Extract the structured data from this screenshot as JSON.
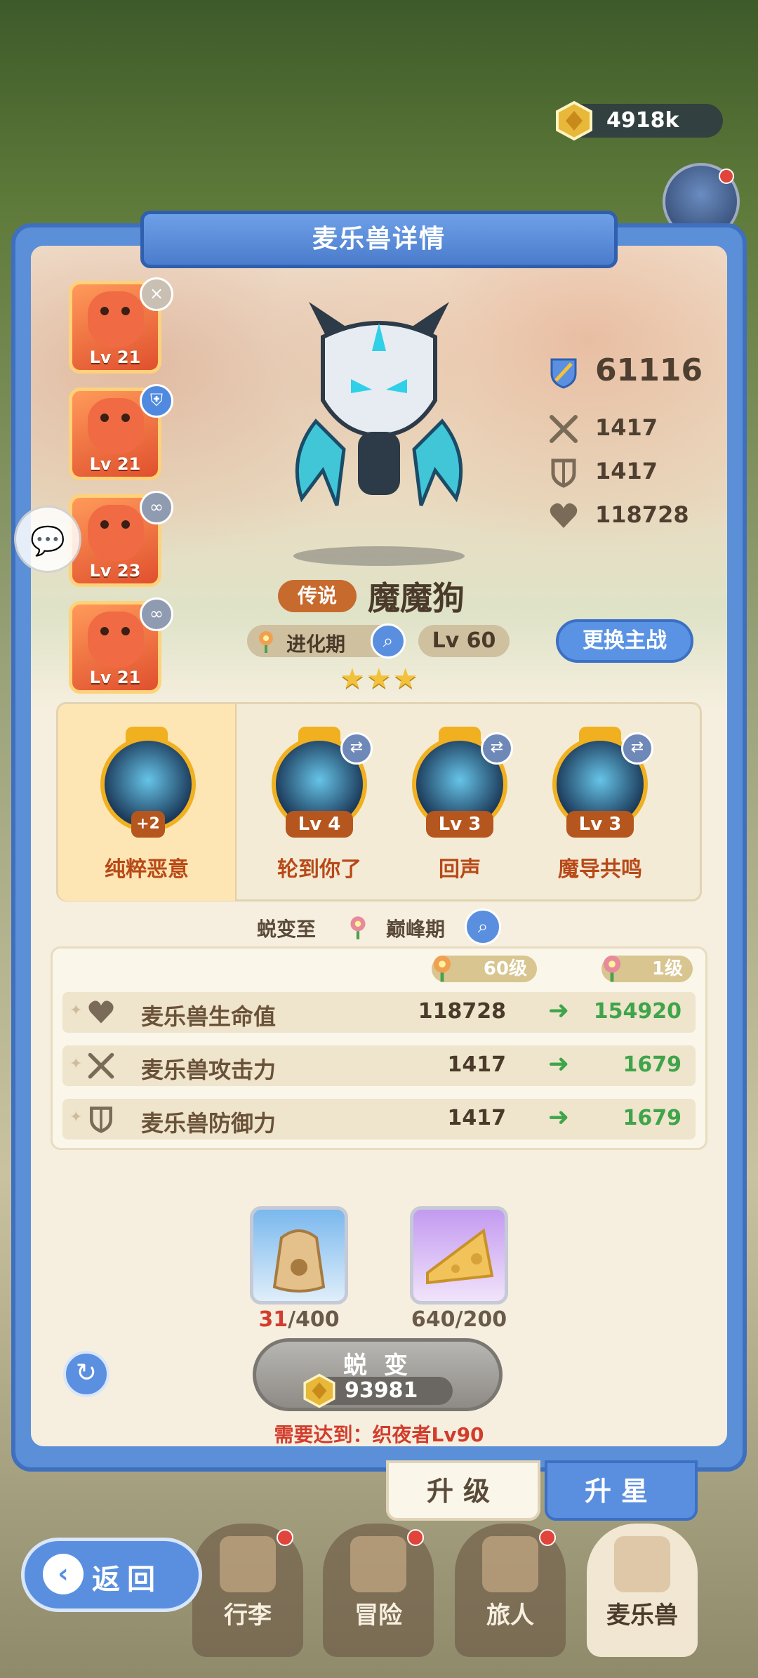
{
  "header": {
    "gold": "4918k",
    "title": "麦乐兽详情"
  },
  "team": [
    {
      "level": "Lv 21",
      "badge": "×"
    },
    {
      "level": "Lv 21",
      "badge": "⛨"
    },
    {
      "level": "Lv 23",
      "badge": "∞"
    },
    {
      "level": "Lv 21",
      "badge": "∞"
    }
  ],
  "monster": {
    "rarity": "传说",
    "name": "魔魔狗",
    "stage": "进化期",
    "level": "Lv 60",
    "stars": "★★★",
    "swap_label": "更换主战",
    "power": "61116",
    "attack": "1417",
    "defense": "1417",
    "hp": "118728"
  },
  "skills": [
    {
      "name": "纯粹恶意",
      "tag": "+2"
    },
    {
      "name": "轮到你了",
      "level": "Lv 4"
    },
    {
      "name": "回声",
      "level": "Lv 3"
    },
    {
      "name": "魔导共鸣",
      "level": "Lv 3"
    }
  ],
  "evolve": {
    "label": "蜕变至",
    "target_stage": "巅峰期",
    "current_level": "60级",
    "next_level": "1级",
    "rows": [
      {
        "label": "麦乐兽生命值",
        "from": "118728",
        "to": "154920"
      },
      {
        "label": "麦乐兽攻击力",
        "from": "1417",
        "to": "1679"
      },
      {
        "label": "麦乐兽防御力",
        "from": "1417",
        "to": "1679"
      }
    ],
    "materials": [
      {
        "have": "31",
        "need": "/400"
      },
      {
        "have": "640",
        "need": "/200"
      }
    ],
    "button": "蜕 变",
    "cost": "93981",
    "requirement": "需要达到：织夜者Lv90"
  },
  "tabs": {
    "upgrade": "升级",
    "star": "升星"
  },
  "nav": {
    "back": "返回",
    "items": [
      "行李",
      "冒险",
      "旅人",
      "麦乐兽"
    ]
  },
  "colors": {
    "panel": "#5b8fd8",
    "accent_orange": "#b84a18",
    "increase_green": "#3fa44a",
    "warn_red": "#d23c2c"
  }
}
